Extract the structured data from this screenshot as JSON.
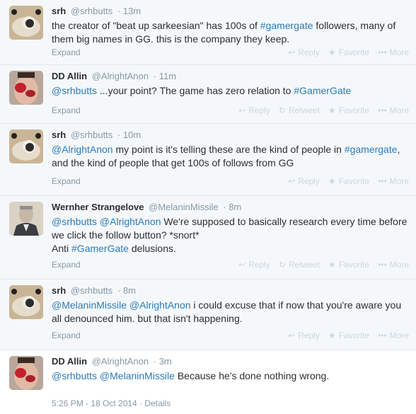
{
  "tweets": [
    {
      "fullname": "srh",
      "username": "@srhbutts",
      "dot": "·",
      "time": "13m",
      "segments": [
        {
          "t": "text",
          "v": "the creator of \"beat up sarkeesian\" has 100s of "
        },
        {
          "t": "link",
          "v": "#gamergate"
        },
        {
          "t": "text",
          "v": " followers, many of them big names in GG. this is the company they keep."
        }
      ],
      "expand": "Expand",
      "actions": [
        "Reply",
        "Favorite",
        "More"
      ]
    },
    {
      "fullname": "DD Allin",
      "username": "@AlrightAnon",
      "dot": "·",
      "time": "11m",
      "segments": [
        {
          "t": "link",
          "v": "@srhbutts"
        },
        {
          "t": "text",
          "v": " ...your point? The game has zero relation to "
        },
        {
          "t": "link",
          "v": "#GamerGate"
        }
      ],
      "expand": "Expand",
      "actions": [
        "Reply",
        "Retweet",
        "Favorite",
        "More"
      ]
    },
    {
      "fullname": "srh",
      "username": "@srhbutts",
      "dot": "·",
      "time": "10m",
      "segments": [
        {
          "t": "link",
          "v": "@AlrightAnon"
        },
        {
          "t": "text",
          "v": " my point is it's telling these are the kind of people in "
        },
        {
          "t": "link",
          "v": "#gamergate"
        },
        {
          "t": "text",
          "v": ", and the kind of people that get 100s of follows from GG"
        }
      ],
      "expand": "Expand",
      "actions": [
        "Reply",
        "Favorite",
        "More"
      ]
    },
    {
      "fullname": "Wernher Strangelove",
      "username": "@MelaninMissile",
      "dot": "·",
      "time": "8m",
      "segments": [
        {
          "t": "link",
          "v": "@srhbutts"
        },
        {
          "t": "text",
          "v": " "
        },
        {
          "t": "link",
          "v": "@AlrightAnon"
        },
        {
          "t": "text",
          "v": " We're supposed to basically research every time before we click the follow button? *snort*"
        },
        {
          "t": "br",
          "v": ""
        },
        {
          "t": "text",
          "v": "Anti "
        },
        {
          "t": "link",
          "v": "#GamerGate"
        },
        {
          "t": "text",
          "v": " delusions."
        }
      ],
      "expand": "Expand",
      "actions": [
        "Reply",
        "Retweet",
        "Favorite",
        "More"
      ]
    },
    {
      "fullname": "srh",
      "username": "@srhbutts",
      "dot": "·",
      "time": "8m",
      "segments": [
        {
          "t": "link",
          "v": "@MelaninMissile"
        },
        {
          "t": "text",
          "v": " "
        },
        {
          "t": "link",
          "v": "@AlrightAnon"
        },
        {
          "t": "text",
          "v": " i could excuse that if now that you're aware you all denounced him. but that isn't happening."
        }
      ],
      "expand": "Expand",
      "actions": [
        "Reply",
        "Favorite",
        "More"
      ]
    },
    {
      "fullname": "DD Allin",
      "username": "@AlrightAnon",
      "dot": "·",
      "time": "3m",
      "segments": [
        {
          "t": "link",
          "v": "@srhbutts"
        },
        {
          "t": "text",
          "v": " "
        },
        {
          "t": "link",
          "v": "@MelaninMissile"
        },
        {
          "t": "text",
          "v": " Because he's done nothing wrong."
        }
      ],
      "meta": {
        "timestamp": "5:26 PM - 18 Oct 2014",
        "sep": "·",
        "details": "Details"
      }
    }
  ],
  "colors": {
    "link": "#2b7bb9",
    "muted": "#8899a6",
    "action": "#ccd6dd",
    "background": "#f5f8fa",
    "text": "#292f33"
  },
  "icons": {
    "Reply": "reply-icon",
    "Retweet": "retweet-icon",
    "Favorite": "favorite-icon",
    "More": "more-icon"
  }
}
